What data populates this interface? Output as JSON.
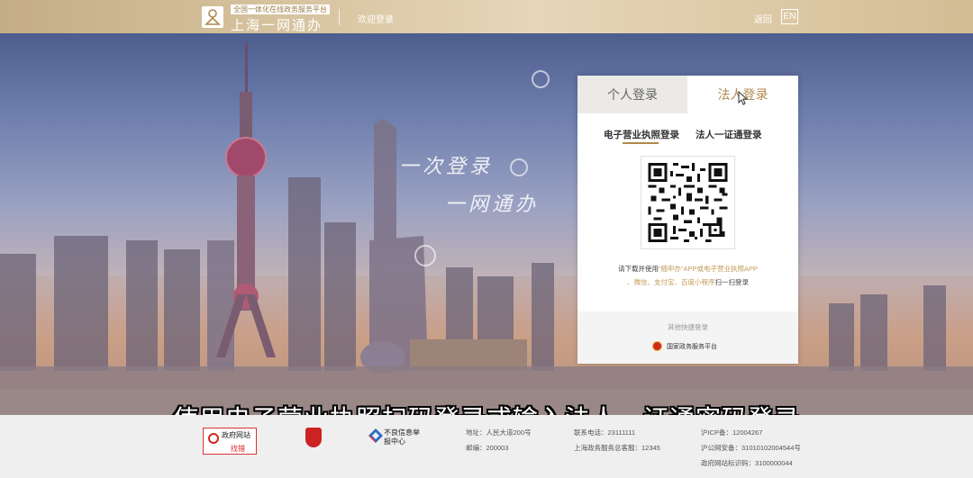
{
  "header": {
    "logo_subtitle": "全国一体化在线政务服务平台",
    "logo_title": "上海一网通办",
    "welcome": "欢迎登录",
    "back": "返回",
    "lang": "EN"
  },
  "hero": {
    "slogan_line1": "一次登录",
    "slogan_line2": "一网通办"
  },
  "login": {
    "tabs": [
      "个人登录",
      "法人登录"
    ],
    "active_tab": "法人登录",
    "subtabs": [
      "电子营业执照登录",
      "法人一证通登录"
    ],
    "active_subtab": "电子营业执照登录",
    "hint": {
      "line1_a": "请下载并使用",
      "line1_b": "“随申办”APP或电子营业执照APP",
      "line2_a": "、微信、支付宝、百度小程序",
      "line2_b": "扫一扫登录"
    },
    "quick_title": "其他快捷登录",
    "quick_item": "国家政务服务平台"
  },
  "caption": "使用电子营业执照扫码登录或输入法人一证通密码登录",
  "footer": {
    "gov_site_line1": "政府网站",
    "gov_site_line2": "找错",
    "report_center": "不良信息举报中心",
    "address": "地址：人民大道200号",
    "postcode": "邮编：200003",
    "phone": "联系电话：23111111",
    "hotline": "上海政务服务总客服：12345",
    "icp": "沪ICP备：12004267",
    "police": "沪公网安备：31010102004544号",
    "site_code": "政府网站标识码：3100000044"
  },
  "colors": {
    "accent_gold": "#b0894e",
    "header_gold": "#d4bd95"
  }
}
